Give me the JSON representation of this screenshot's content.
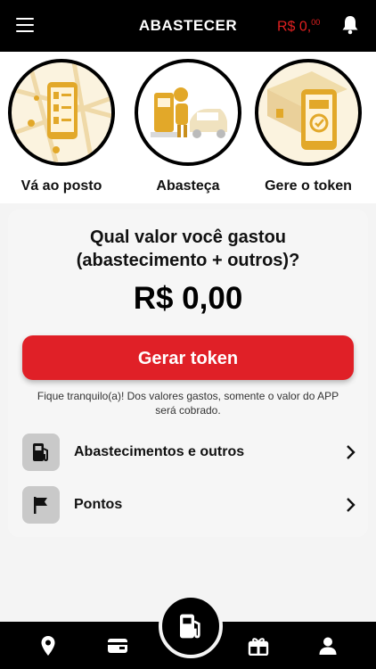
{
  "header": {
    "title": "ABASTECER",
    "balance_main": "R$ 0,",
    "balance_cents": "00"
  },
  "steps": [
    {
      "label": "Vá ao posto"
    },
    {
      "label": "Abasteça"
    },
    {
      "label": "Gere o token"
    }
  ],
  "card": {
    "question_line1": "Qual valor você gastou",
    "question_line2": "(abastecimento + outros)?",
    "amount": "R$ 0,00",
    "button_label": "Gerar token",
    "note_line1": "Fique tranquilo(a)! Dos valores gastos, somente o valor do APP",
    "note_line2": "será cobrado."
  },
  "rows": [
    {
      "label": "Abastecimentos e outros",
      "icon": "fuel-pump-icon"
    },
    {
      "label": "Pontos",
      "icon": "flag-icon"
    }
  ],
  "colors": {
    "accent": "#e02027",
    "illustration": "#e2a829",
    "bar": "#000000"
  },
  "bottom_nav": [
    "location-pin-icon",
    "wallet-icon",
    "fuel-pump-icon",
    "gift-icon",
    "profile-icon"
  ]
}
